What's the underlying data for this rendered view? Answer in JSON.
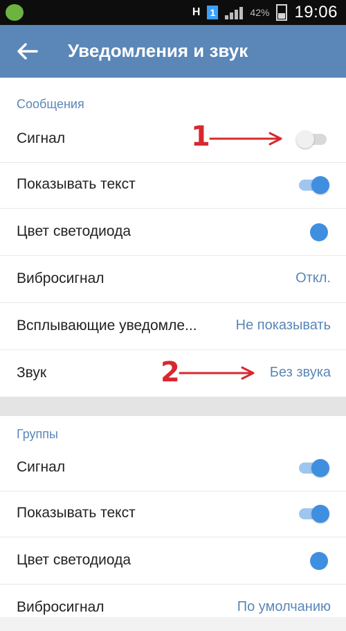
{
  "status_bar": {
    "network_label": "H",
    "sim_label": "1",
    "battery_text": "42%",
    "time": "19:06",
    "icons": [
      "android-icon",
      "signal-icon",
      "battery-icon"
    ]
  },
  "app_bar": {
    "title": "Уведомления и звук",
    "back_icon": "arrow-left-icon",
    "background_color": "#5a86b8"
  },
  "messages": {
    "section_title": "Сообщения",
    "items": [
      {
        "label": "Сигнал",
        "type": "switch",
        "on": false
      },
      {
        "label": "Показывать текст",
        "type": "switch",
        "on": true
      },
      {
        "label": "Цвет светодиода",
        "type": "color",
        "color": "#3f8fe0"
      },
      {
        "label": "Вибросигнал",
        "type": "value",
        "value": "Откл."
      },
      {
        "label": "Всплывающие уведомле...",
        "type": "value",
        "value": "Не показывать"
      },
      {
        "label": "Звук",
        "type": "value",
        "value": "Без звука"
      }
    ]
  },
  "groups": {
    "section_title": "Группы",
    "items": [
      {
        "label": "Сигнал",
        "type": "switch",
        "on": true
      },
      {
        "label": "Показывать текст",
        "type": "switch",
        "on": true
      },
      {
        "label": "Цвет светодиода",
        "type": "color",
        "color": "#3f8fe0"
      },
      {
        "label": "Вибросигнал",
        "type": "value",
        "value": "По умолчанию"
      }
    ]
  },
  "annotations": [
    {
      "number": "1",
      "color": "#d8282f"
    },
    {
      "number": "2",
      "color": "#d8282f"
    }
  ],
  "accent_color": "#3f8fe0"
}
